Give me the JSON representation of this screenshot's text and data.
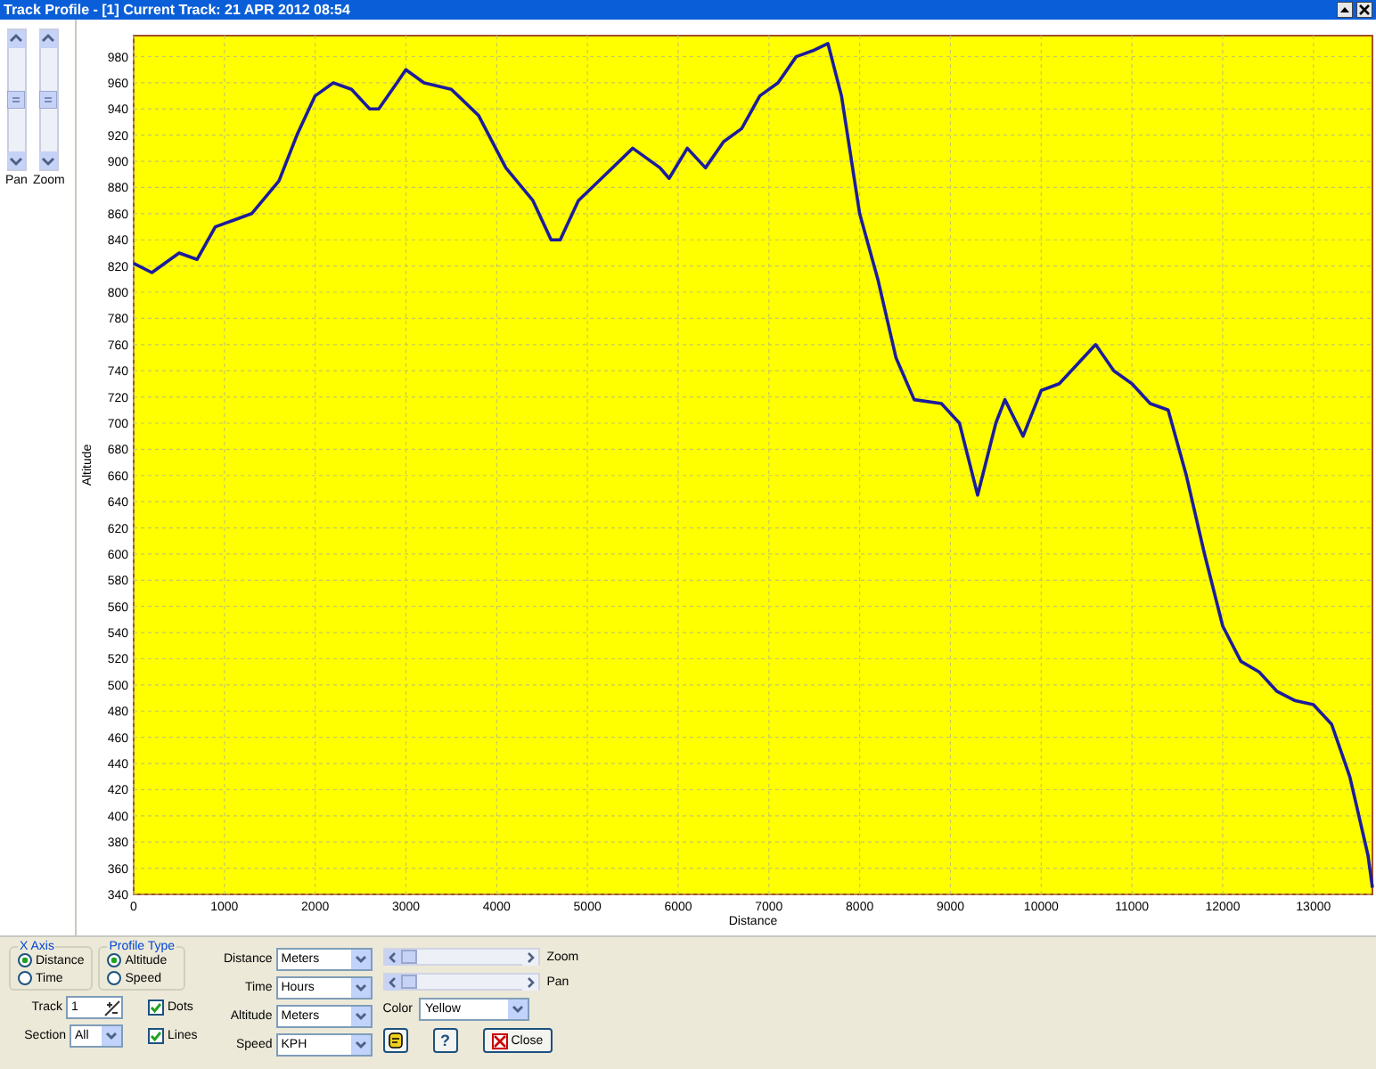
{
  "window": {
    "title": "Track Profile - [1] Current Track: 21 APR 2012 08:54"
  },
  "side_scrollbars": [
    {
      "label": "Pan"
    },
    {
      "label": "Zoom"
    }
  ],
  "chart": {
    "chart_data": {
      "type": "line",
      "grid": true,
      "xlabel": "Distance",
      "ylabel": "Altitude",
      "xlim": [
        0,
        13650
      ],
      "ylim": [
        340,
        996
      ],
      "xticks": [
        0,
        1000,
        2000,
        3000,
        4000,
        5000,
        6000,
        7000,
        8000,
        9000,
        10000,
        11000,
        12000,
        13000
      ],
      "yticks": [
        340,
        360,
        380,
        400,
        420,
        440,
        460,
        480,
        500,
        520,
        540,
        560,
        580,
        600,
        620,
        640,
        660,
        680,
        700,
        720,
        740,
        760,
        780,
        800,
        820,
        840,
        860,
        880,
        900,
        920,
        940,
        960,
        980
      ],
      "x": [
        0,
        200,
        500,
        700,
        900,
        1100,
        1300,
        1600,
        1800,
        2000,
        2200,
        2400,
        2600,
        2700,
        2900,
        3000,
        3200,
        3500,
        3800,
        4100,
        4400,
        4600,
        4700,
        4900,
        5200,
        5500,
        5800,
        5900,
        6100,
        6300,
        6500,
        6700,
        6900,
        7100,
        7300,
        7500,
        7650,
        7800,
        8000,
        8200,
        8400,
        8600,
        8900,
        9100,
        9300,
        9500,
        9600,
        9800,
        10000,
        10200,
        10400,
        10600,
        10800,
        11000,
        11200,
        11400,
        11600,
        11800,
        12000,
        12200,
        12400,
        12600,
        12800,
        13000,
        13200,
        13400,
        13600,
        13650
      ],
      "series": [
        {
          "color": "#1c1c9c",
          "values": [
            822,
            815,
            830,
            825,
            850,
            855,
            860,
            885,
            920,
            950,
            960,
            955,
            940,
            940,
            960,
            970,
            960,
            955,
            935,
            895,
            870,
            840,
            840,
            870,
            890,
            910,
            895,
            887,
            910,
            895,
            915,
            925,
            950,
            960,
            980,
            985,
            990,
            950,
            860,
            810,
            750,
            718,
            715,
            700,
            645,
            700,
            718,
            690,
            725,
            730,
            745,
            760,
            740,
            730,
            715,
            710,
            660,
            600,
            545,
            518,
            510,
            495,
            488,
            485,
            470,
            430,
            370,
            345
          ]
        }
      ]
    }
  },
  "controls": {
    "groups": [
      {
        "title": "X Axis",
        "options": [
          {
            "label": "Distance",
            "selected": true
          },
          {
            "label": "Time",
            "selected": false
          }
        ]
      },
      {
        "title": "Profile Type",
        "options": [
          {
            "label": "Altitude",
            "selected": true
          },
          {
            "label": "Speed",
            "selected": false
          }
        ]
      }
    ],
    "track": {
      "label": "Track",
      "value": "1"
    },
    "section": {
      "label": "Section",
      "value": "All"
    },
    "checkboxes": [
      {
        "label": "Dots",
        "checked": true
      },
      {
        "label": "Lines",
        "checked": true
      }
    ],
    "units": [
      {
        "label": "Distance",
        "value": "Meters"
      },
      {
        "label": "Time",
        "value": "Hours"
      },
      {
        "label": "Altitude",
        "value": "Meters"
      },
      {
        "label": "Speed",
        "value": "KPH"
      }
    ],
    "sliders": [
      {
        "label": "Zoom"
      },
      {
        "label": "Pan"
      }
    ],
    "color": {
      "label": "Color",
      "value": "Yellow"
    },
    "buttons": [
      {
        "kind": "image"
      },
      {
        "kind": "text",
        "label": "?"
      },
      {
        "kind": "close",
        "label": "Close"
      }
    ]
  }
}
